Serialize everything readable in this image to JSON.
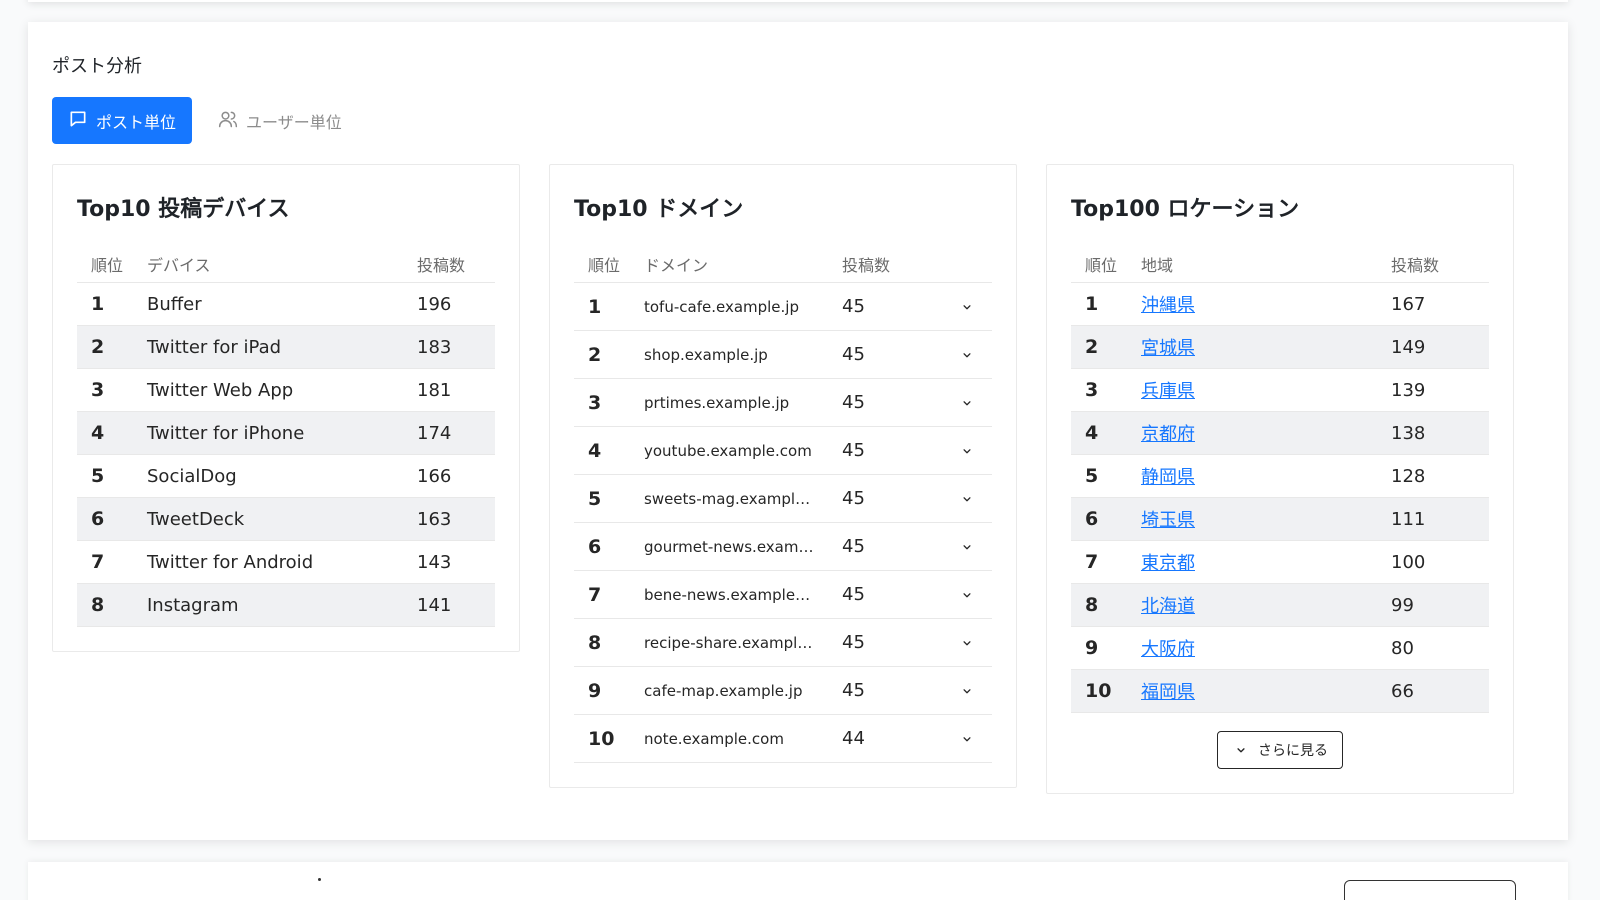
{
  "section_title": "ポスト分析",
  "tabs": [
    {
      "label": "ポスト単位",
      "icon": "message-square-icon",
      "active": true
    },
    {
      "label": "ユーザー単位",
      "icon": "users-icon",
      "active": false
    }
  ],
  "colors": {
    "accent": "#1677ff",
    "stripe": "#f0f1f3"
  },
  "devices": {
    "title": "Top10 投稿デバイス",
    "headers": {
      "rank": "順位",
      "name": "デバイス",
      "count": "投稿数"
    },
    "rows": [
      {
        "rank": "1",
        "name": "Buffer",
        "count": "196"
      },
      {
        "rank": "2",
        "name": "Twitter for iPad",
        "count": "183"
      },
      {
        "rank": "3",
        "name": "Twitter Web App",
        "count": "181"
      },
      {
        "rank": "4",
        "name": "Twitter for iPhone",
        "count": "174"
      },
      {
        "rank": "5",
        "name": "SocialDog",
        "count": "166"
      },
      {
        "rank": "6",
        "name": "TweetDeck",
        "count": "163"
      },
      {
        "rank": "7",
        "name": "Twitter for Android",
        "count": "143"
      },
      {
        "rank": "8",
        "name": "Instagram",
        "count": "141"
      }
    ]
  },
  "domains": {
    "title": "Top10 ドメイン",
    "headers": {
      "rank": "順位",
      "name": "ドメイン",
      "count": "投稿数"
    },
    "rows": [
      {
        "rank": "1",
        "name": "tofu-cafe.example.jp",
        "count": "45"
      },
      {
        "rank": "2",
        "name": "shop.example.jp",
        "count": "45"
      },
      {
        "rank": "3",
        "name": "prtimes.example.jp",
        "count": "45"
      },
      {
        "rank": "4",
        "name": "youtube.example.com",
        "count": "45"
      },
      {
        "rank": "5",
        "name": "sweets-mag.example.jp",
        "count": "45"
      },
      {
        "rank": "6",
        "name": "gourmet-news.example.c…",
        "count": "45"
      },
      {
        "rank": "7",
        "name": "bene-news.example.com",
        "count": "45"
      },
      {
        "rank": "8",
        "name": "recipe-share.example.jp",
        "count": "45"
      },
      {
        "rank": "9",
        "name": "cafe-map.example.jp",
        "count": "45"
      },
      {
        "rank": "10",
        "name": "note.example.com",
        "count": "44"
      }
    ]
  },
  "locations": {
    "title": "Top100 ロケーション",
    "headers": {
      "rank": "順位",
      "name": "地域",
      "count": "投稿数"
    },
    "rows": [
      {
        "rank": "1",
        "name": "沖縄県",
        "count": "167"
      },
      {
        "rank": "2",
        "name": "宮城県",
        "count": "149"
      },
      {
        "rank": "3",
        "name": "兵庫県",
        "count": "139"
      },
      {
        "rank": "4",
        "name": "京都府",
        "count": "138"
      },
      {
        "rank": "5",
        "name": "静岡県",
        "count": "128"
      },
      {
        "rank": "6",
        "name": "埼玉県",
        "count": "111"
      },
      {
        "rank": "7",
        "name": "東京都",
        "count": "100"
      },
      {
        "rank": "8",
        "name": "北海道",
        "count": "99"
      },
      {
        "rank": "9",
        "name": "大阪府",
        "count": "80"
      },
      {
        "rank": "10",
        "name": "福岡県",
        "count": "66"
      }
    ],
    "more_label": "さらに見る"
  }
}
